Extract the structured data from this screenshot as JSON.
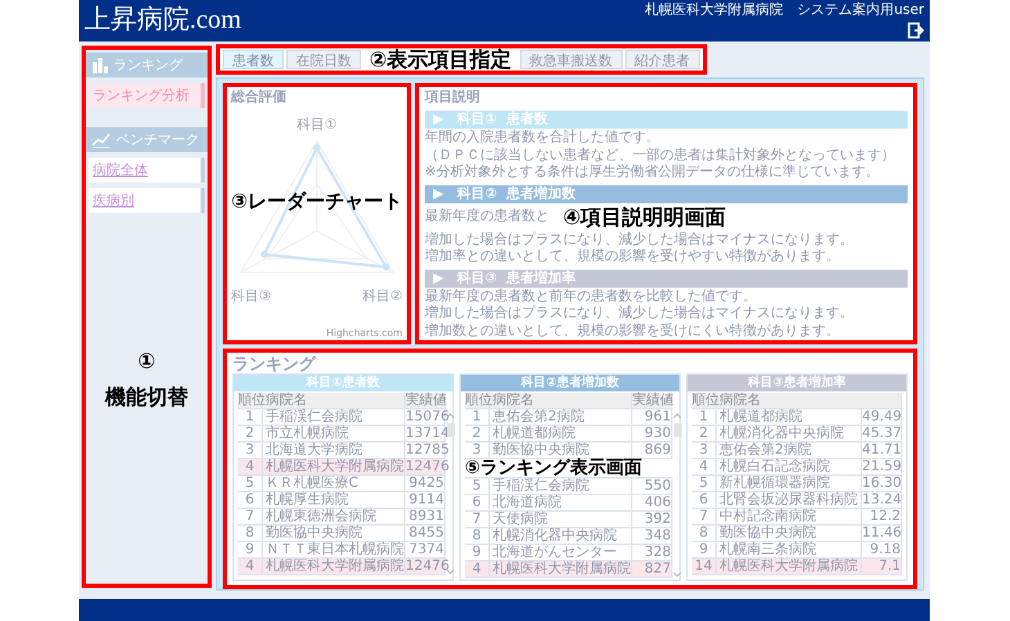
{
  "header": {
    "logo": "上昇病院.com",
    "user": "札幌医科大学附属病院　システム案内用user"
  },
  "sidebar": {
    "sections": [
      {
        "title": "ランキング",
        "items": [
          {
            "label": "ランキング分析",
            "selected": true
          }
        ]
      },
      {
        "title": "ベンチマーク",
        "items": [
          {
            "label": "病院全体",
            "selected": false
          },
          {
            "label": "疾病別",
            "selected": false
          }
        ]
      }
    ],
    "annotation": {
      "number": "①",
      "label": "機能切替"
    }
  },
  "tab_bar": {
    "tabs_before": [
      {
        "label": "患者数",
        "selected": true
      },
      {
        "label": "在院日数",
        "selected": false
      }
    ],
    "annotation": "②表示項目指定",
    "tabs_after": [
      {
        "label": "救急車搬送数",
        "selected": false
      },
      {
        "label": "紹介患者",
        "selected": false
      }
    ]
  },
  "radar": {
    "title": "総合評価",
    "axes": [
      "科目①",
      "科目②",
      "科目③"
    ],
    "credit": "Highcharts.com",
    "annotation": "③レーダーチャート"
  },
  "description": {
    "title": "項目説明",
    "annotation": "④項目説明明画面",
    "sections": [
      {
        "heading": "▶　科目①  患者数",
        "color": "#bfe6f7",
        "lines": [
          "年間の入院患者数を合計した値です。",
          "（ＤＰＣに該当しない患者など、一部の患者は集計対象外となっています）",
          "※分析対象外とする条件は厚生労働省公開データの仕様に準じています。"
        ]
      },
      {
        "heading": "▶　科目②  患者増加数",
        "color": "#94bde0",
        "lines": [
          "最新年度の患者数と",
          "増加した場合はプラスになり、減少した場合はマイナスになります。",
          "増加率との違いとして、規模の影響を受けやすい特徴があります。"
        ]
      },
      {
        "heading": "▶　科目③  患者増加率",
        "color": "#c3c7d6",
        "lines": [
          "最新年度の患者数と前年の患者数を比較した値です。",
          "増加した場合はプラスになり、減少した場合はマイナスになります。",
          "増加数との違いとして、規模の影響を受けにくい特徴があります。"
        ]
      }
    ]
  },
  "ranking": {
    "title": "ランキング",
    "tables": [
      {
        "title": "科目①患者数",
        "color": "#bfe6f7",
        "scrollable": true,
        "columns": [
          "順位",
          "病院名",
          "実績値"
        ],
        "rows": [
          {
            "rank": "1",
            "name": "手稲渓仁会病院",
            "value": "15076",
            "highlighted": false
          },
          {
            "rank": "2",
            "name": "市立札幌病院",
            "value": "13714",
            "highlighted": false
          },
          {
            "rank": "3",
            "name": "北海道大学病院",
            "value": "12785",
            "highlighted": false
          },
          {
            "rank": "4",
            "name": "札幌医科大学附属病院",
            "value": "12476",
            "highlighted": true
          },
          {
            "rank": "5",
            "name": "ＫＲ札幌医療C",
            "value": "9425",
            "highlighted": false
          },
          {
            "rank": "6",
            "name": "札幌厚生病院",
            "value": "9114",
            "highlighted": false
          },
          {
            "rank": "7",
            "name": "札幌東徳洲会病院",
            "value": "8931",
            "highlighted": false
          },
          {
            "rank": "8",
            "name": "勤医協中央病院",
            "value": "8455",
            "highlighted": false
          },
          {
            "rank": "9",
            "name": "ＮＴＴ東日本札幌病院",
            "value": "7374",
            "highlighted": false
          },
          {
            "rank": "4",
            "name": "札幌医科大学附属病院",
            "value": "12476",
            "highlighted": true
          }
        ]
      },
      {
        "title": "科目②患者増加数",
        "color": "#94bde0",
        "scrollable": true,
        "columns": [
          "順位",
          "病院名",
          "実績値"
        ],
        "rows": [
          {
            "rank": "1",
            "name": "恵佑会第2病院",
            "value": "961",
            "highlighted": false
          },
          {
            "rank": "2",
            "name": "札幌道都病院",
            "value": "930",
            "highlighted": false
          },
          {
            "rank": "3",
            "name": "勤医協中央病院",
            "value": "869",
            "highlighted": false
          },
          {
            "covered": true,
            "annotation": "⑤ランキング表示画面"
          },
          {
            "rank": "5",
            "name": "手稲渓仁会病院",
            "value": "550",
            "highlighted": false
          },
          {
            "rank": "6",
            "name": "北海道病院",
            "value": "406",
            "highlighted": false
          },
          {
            "rank": "7",
            "name": "天使病院",
            "value": "392",
            "highlighted": false
          },
          {
            "rank": "8",
            "name": "札幌消化器中央病院",
            "value": "348",
            "highlighted": false
          },
          {
            "rank": "9",
            "name": "北海道がんセンター",
            "value": "328",
            "highlighted": false
          },
          {
            "rank": "4",
            "name": "札幌医科大学附属病院",
            "value": "827",
            "highlighted": true
          }
        ]
      },
      {
        "title": "科目③患者増加率",
        "color": "#c3c7d6",
        "scrollable": false,
        "columns": [
          "順位",
          "病院名"
        ],
        "rows": [
          {
            "rank": "1",
            "name": "札幌道都病院",
            "value": "49.49",
            "highlighted": false
          },
          {
            "rank": "2",
            "name": "札幌消化器中央病院",
            "value": "45.37",
            "highlighted": false
          },
          {
            "rank": "3",
            "name": "恵佑会第2病院",
            "value": "41.71",
            "highlighted": false
          },
          {
            "rank": "4",
            "name": "札幌白石記念病院",
            "value": "21.59",
            "highlighted": false
          },
          {
            "rank": "5",
            "name": "新札幌循環器病院",
            "value": "16.30",
            "highlighted": false
          },
          {
            "rank": "6",
            "name": "北腎会坂泌尿器科病院",
            "value": "13.24",
            "highlighted": false
          },
          {
            "rank": "7",
            "name": "中村記念南病院",
            "value": "12.2",
            "highlighted": false
          },
          {
            "rank": "8",
            "name": "勤医協中央病院",
            "value": "11.46",
            "highlighted": false
          },
          {
            "rank": "9",
            "name": "札幌南三条病院",
            "value": "9.18",
            "highlighted": false
          },
          {
            "rank": "14",
            "name": "札幌医科大学附属病院",
            "value": "7.1",
            "highlighted": true
          }
        ]
      }
    ]
  }
}
